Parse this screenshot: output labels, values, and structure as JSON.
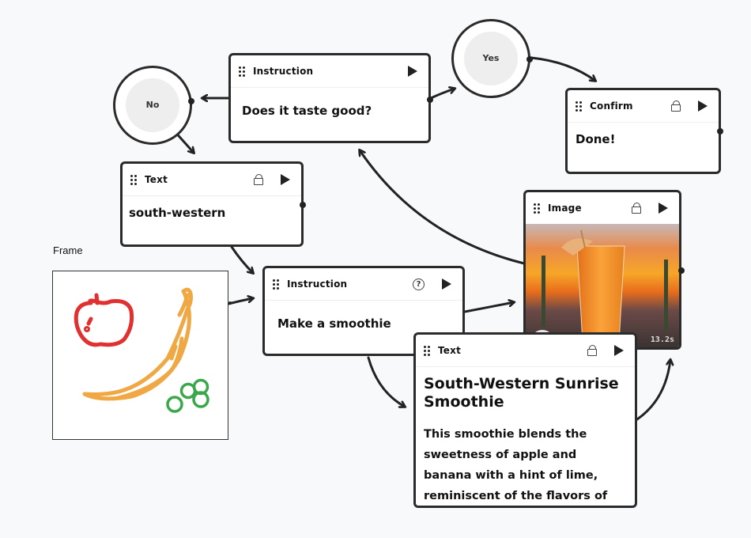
{
  "nodes": {
    "instruction_top": {
      "type": "Instruction",
      "content": "Does it taste good?"
    },
    "no": {
      "label": "No"
    },
    "yes": {
      "label": "Yes"
    },
    "confirm": {
      "type": "Confirm",
      "content": "Done!"
    },
    "text_small": {
      "type": "Text",
      "content": "south-western"
    },
    "instruction_mid": {
      "type": "Instruction",
      "content": "Make a smoothie",
      "help_glyph": "?"
    },
    "image": {
      "type": "Image",
      "timer": "13.2s"
    },
    "text_big": {
      "type": "Text",
      "title": "South-Western Sunrise Smoothie",
      "body": "This smoothie blends the sweetness of apple and banana with a hint of lime, reminiscent of the flavors of"
    }
  },
  "frame": {
    "label": "Frame",
    "drawing": [
      "apple",
      "banana",
      "grapes"
    ]
  },
  "colors": {
    "apple": "#e03030",
    "banana": "#f0a845",
    "grapes": "#3aa84a",
    "edge": "#222222",
    "background": "#f8f9fb"
  }
}
